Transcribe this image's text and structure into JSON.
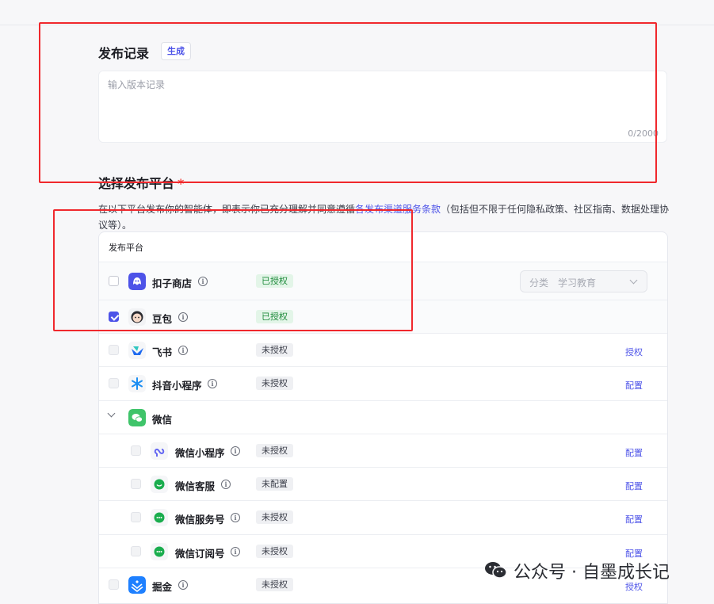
{
  "release_notes": {
    "title": "发布记录",
    "generate_label": "生成",
    "placeholder": "输入版本记录",
    "counter": "0/2000"
  },
  "platforms": {
    "title": "选择发布平台",
    "required_mark": "*",
    "description_before": "在以下平台发布你的智能体，即表示你已充分理解并同意遵循",
    "description_link": "各发布渠道服务条款",
    "description_after": "（包括但不限于任何隐私政策、社区指南、数据处理协议等）。",
    "table_header": "发布平台",
    "category_select": {
      "label": "分类",
      "value": "学习教育"
    },
    "rows": [
      {
        "name": "扣子商店",
        "status": "已授权",
        "checked": false
      },
      {
        "name": "豆包",
        "status": "已授权",
        "checked": true
      },
      {
        "name": "飞书",
        "status": "未授权",
        "action": "授权"
      },
      {
        "name": "抖音小程序",
        "status": "未授权",
        "action": "配置"
      },
      {
        "name": "微信"
      },
      {
        "name": "微信小程序",
        "status": "未授权",
        "action": "配置"
      },
      {
        "name": "微信客服",
        "status": "未配置",
        "action": "配置"
      },
      {
        "name": "微信服务号",
        "status": "未授权",
        "action": "配置"
      },
      {
        "name": "微信订阅号",
        "status": "未授权",
        "action": "配置"
      },
      {
        "name": "掘金",
        "status": "未授权",
        "action": "授权"
      }
    ]
  },
  "watermark": {
    "text": "公众号 · 自墨成长记"
  },
  "colors": {
    "accent": "#4d53e8",
    "annotation_red": "#f0282d",
    "authorized_green": "#1d8a3a"
  }
}
